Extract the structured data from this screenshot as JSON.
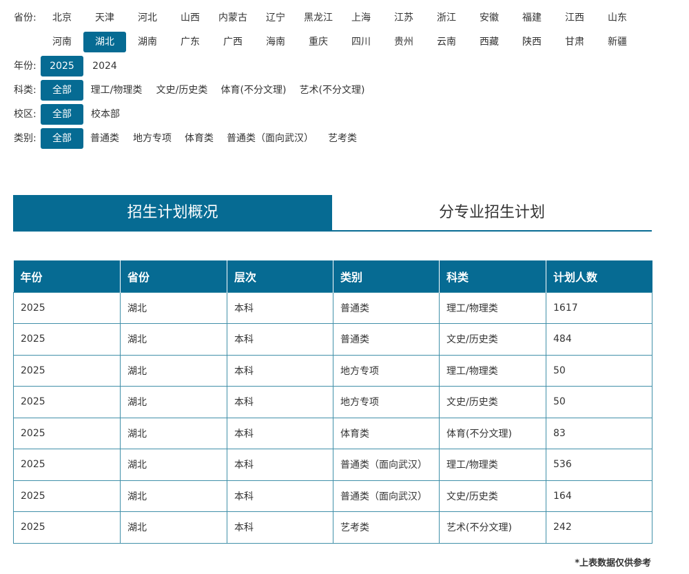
{
  "filters": {
    "province": {
      "label": "省份:",
      "row1": [
        "北京",
        "天津",
        "河北",
        "山西",
        "内蒙古",
        "辽宁",
        "黑龙江",
        "上海",
        "江苏",
        "浙江",
        "安徽",
        "福建",
        "江西",
        "山东"
      ],
      "row2": [
        "河南",
        "湖北",
        "湖南",
        "广东",
        "广西",
        "海南",
        "重庆",
        "四川",
        "贵州",
        "云南",
        "西藏",
        "陕西",
        "甘肃",
        "新疆"
      ],
      "selected": "湖北"
    },
    "year": {
      "label": "年份:",
      "options": [
        "2025",
        "2024"
      ],
      "selected": "2025"
    },
    "subject": {
      "label": "科类:",
      "options": [
        "全部",
        "理工/物理类",
        "文史/历史类",
        "体育(不分文理)",
        "艺术(不分文理)"
      ],
      "selected": "全部"
    },
    "campus": {
      "label": "校区:",
      "options": [
        "全部",
        "校本部"
      ],
      "selected": "全部"
    },
    "category": {
      "label": "类别:",
      "options": [
        "全部",
        "普通类",
        "地方专项",
        "体育类",
        "普通类（面向武汉）",
        "艺考类"
      ],
      "selected": "全部"
    }
  },
  "tabs": [
    {
      "label": "招生计划概况",
      "active": true
    },
    {
      "label": "分专业招生计划",
      "active": false
    }
  ],
  "table": {
    "headers": [
      "年份",
      "省份",
      "层次",
      "类别",
      "科类",
      "计划人数"
    ],
    "rows": [
      [
        "2025",
        "湖北",
        "本科",
        "普通类",
        "理工/物理类",
        "1617"
      ],
      [
        "2025",
        "湖北",
        "本科",
        "普通类",
        "文史/历史类",
        "484"
      ],
      [
        "2025",
        "湖北",
        "本科",
        "地方专项",
        "理工/物理类",
        "50"
      ],
      [
        "2025",
        "湖北",
        "本科",
        "地方专项",
        "文史/历史类",
        "50"
      ],
      [
        "2025",
        "湖北",
        "本科",
        "体育类",
        "体育(不分文理)",
        "83"
      ],
      [
        "2025",
        "湖北",
        "本科",
        "普通类（面向武汉）",
        "理工/物理类",
        "536"
      ],
      [
        "2025",
        "湖北",
        "本科",
        "普通类（面向武汉）",
        "文史/历史类",
        "164"
      ],
      [
        "2025",
        "湖北",
        "本科",
        "艺考类",
        "艺术(不分文理)",
        "242"
      ]
    ]
  },
  "footnote": "*上表数据仅供参考",
  "colors": {
    "accent": "#066b93",
    "text": "#333333",
    "border": "#3f8fa8"
  }
}
